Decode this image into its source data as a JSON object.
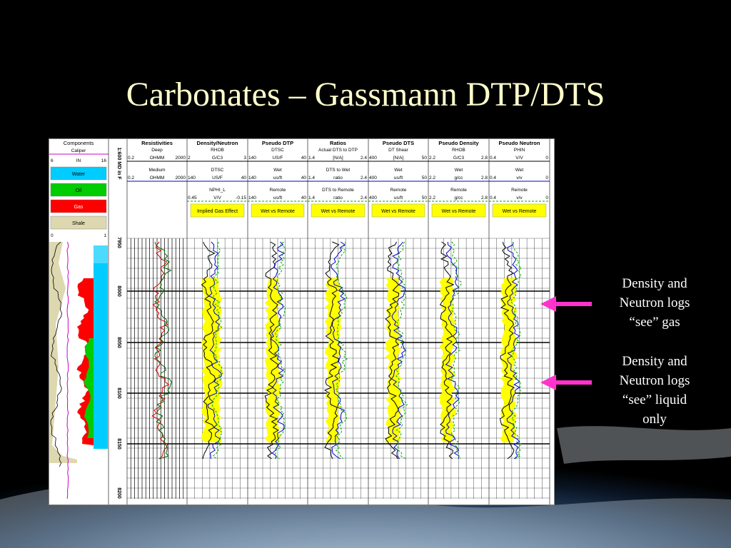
{
  "slide": {
    "title": "Carbonates – Gassmann DTP/DTS",
    "annotations": [
      {
        "lines": [
          "Density and",
          "Neutron logs",
          "“see” gas"
        ]
      },
      {
        "lines": [
          "Density and",
          "Neutron logs",
          "“see” liquid",
          "only"
        ]
      }
    ],
    "colors": {
      "title": "#ffffcc",
      "arrow": "#ff33cc",
      "yellow_fill": "#ffff00",
      "gas": "#ff0000",
      "oil": "#00cc00",
      "water": "#00ccff",
      "shale": "#ddd8b0"
    }
  },
  "log": {
    "scale_label": "1:600 MD in F",
    "depths": [
      "7950",
      "8000",
      "8050",
      "8100",
      "8150",
      "8200"
    ],
    "components": {
      "title": "Components",
      "caliper_label": "Caliper",
      "caliper_scale": [
        "6",
        "IN",
        "16"
      ],
      "legend": [
        {
          "label": "Water",
          "color": "#00ccff"
        },
        {
          "label": "Oil",
          "color": "#00cc00"
        },
        {
          "label": "Gas",
          "color": "#ff0000"
        },
        {
          "label": "Shale",
          "color": "#ddd8b0"
        }
      ],
      "bottom_scale": [
        "0",
        "1"
      ]
    },
    "tracks": [
      {
        "title": "Resistivities",
        "rows": [
          {
            "name": "Deep",
            "scale": [
              "0.2",
              "OHMM",
              "2000"
            ]
          },
          {
            "name": "Medium",
            "scale": [
              "0.2",
              "OHMM",
              "2000"
            ]
          }
        ],
        "button": ""
      },
      {
        "title": "Density/Neutron",
        "rows": [
          {
            "name": "RHOB",
            "scale": [
              "2",
              "G/C3",
              "3"
            ]
          },
          {
            "name": "DTSC",
            "scale": [
              "140",
              "US/F",
              "40"
            ]
          },
          {
            "name": "NPHI_L",
            "scale": [
              "0.45",
              "V/V",
              "-0.15"
            ]
          }
        ],
        "button": "Implied Gas Effect"
      },
      {
        "title": "Pseudo DTP",
        "rows": [
          {
            "name": "DTSC",
            "scale": [
              "140",
              "US/F",
              "40"
            ]
          },
          {
            "name": "Wet",
            "scale": [
              "140",
              "us/ft",
              "40"
            ]
          },
          {
            "name": "Remote",
            "scale": [
              "140",
              "us/ft",
              "40"
            ]
          }
        ],
        "button": "Wet vs Remote"
      },
      {
        "title": "Ratios",
        "rows": [
          {
            "name": "Actual DTS to DTP",
            "scale": [
              "1.4",
              "[N/A]",
              "2.4"
            ]
          },
          {
            "name": "DTS to Wet",
            "scale": [
              "1.4",
              "ratio",
              "2.4"
            ]
          },
          {
            "name": "DTS to Remote",
            "scale": [
              "1.4",
              "ratio",
              "2.4"
            ]
          }
        ],
        "button": "Wet vs Remote"
      },
      {
        "title": "Pseudo DTS",
        "rows": [
          {
            "name": "DT Shear",
            "scale": [
              "400",
              "[N/A]",
              "50"
            ]
          },
          {
            "name": "Wet",
            "scale": [
              "400",
              "us/ft",
              "50"
            ]
          },
          {
            "name": "Remote",
            "scale": [
              "400",
              "us/ft",
              "50"
            ]
          }
        ],
        "button": "Wet vs Remote"
      },
      {
        "title": "Pseudo Density",
        "rows": [
          {
            "name": "RHOB",
            "scale": [
              "2.2",
              "G/C3",
              "2.8"
            ]
          },
          {
            "name": "Wet",
            "scale": [
              "2.2",
              "g/cc",
              "2.8"
            ]
          },
          {
            "name": "Remote",
            "scale": [
              "2.2",
              "g/cc",
              "2.8"
            ]
          }
        ],
        "button": "Wet vs Remote"
      },
      {
        "title": "Pseudo Neutron",
        "rows": [
          {
            "name": "PHIN",
            "scale": [
              "0.4",
              "V/V",
              "0"
            ]
          },
          {
            "name": "Wet",
            "scale": [
              "0.4",
              "v/v",
              "0"
            ]
          },
          {
            "name": "Remote",
            "scale": [
              "0.4",
              "v/v",
              "0"
            ]
          }
        ],
        "button": "Wet vs Remote"
      }
    ]
  }
}
